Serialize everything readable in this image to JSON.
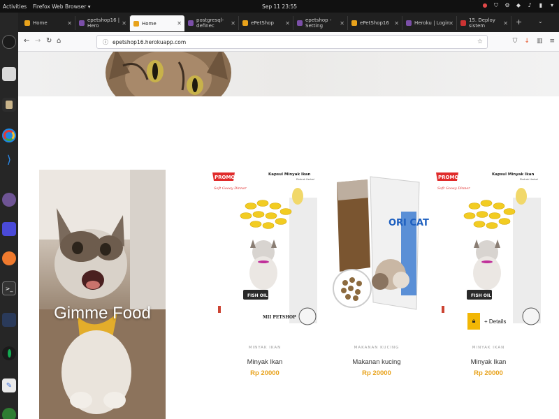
{
  "system": {
    "activities": "Activities",
    "app_name": "Firefox Web Browser ▾",
    "clock": "Sep 11  23:55"
  },
  "browser": {
    "tabs": [
      {
        "label": "Home",
        "active": false,
        "favicon_color": "#e8a21b"
      },
      {
        "label": "epetshop16 | Hero",
        "active": false,
        "favicon_color": "#7b4fa8"
      },
      {
        "label": "Home",
        "active": true,
        "favicon_color": "#e8a21b"
      },
      {
        "label": "postgresql-definec",
        "active": false,
        "favicon_color": "#7b4fa8"
      },
      {
        "label": "ePetShop",
        "active": false,
        "favicon_color": "#e8a21b"
      },
      {
        "label": "epetshop - Setting",
        "active": false,
        "favicon_color": "#7b4fa8"
      },
      {
        "label": "ePetShop16",
        "active": false,
        "favicon_color": "#e8a21b"
      },
      {
        "label": "Heroku | Login",
        "active": false,
        "favicon_color": "#7b4fa8"
      },
      {
        "label": "15. Deploy sistem",
        "active": false,
        "favicon_color": "#cc3333"
      }
    ],
    "url": "epetshop16.herokuapp.com"
  },
  "promo": {
    "text": "Gimme Food"
  },
  "products": [
    {
      "category": "MINYAK IKAN",
      "name": "Minyak Ikan",
      "price": "Rp 20000"
    },
    {
      "category": "MAKANAN KUCING",
      "name": "Makanan kucing",
      "price": "Rp 20000"
    },
    {
      "category": "MINYAK IKAN",
      "name": "Minyak Ikan",
      "price": "Rp 20000"
    }
  ],
  "product_image_text": {
    "promo_badge": "PROMO",
    "promo_sub": "Soft Gooey Dinner",
    "capsule_title": "Kapsul Minyak Ikan",
    "capsule_sub": "Ekstrak Herbal",
    "fish_oil": "FISH OIL",
    "shop_name": "MII PETSHOP",
    "bag_brand": "ORI CAT"
  },
  "hover": {
    "details_label": "+ Details"
  },
  "colors": {
    "accent": "#e8a21b",
    "cart_button": "#f2b705",
    "promo_red": "#e02b2b"
  }
}
